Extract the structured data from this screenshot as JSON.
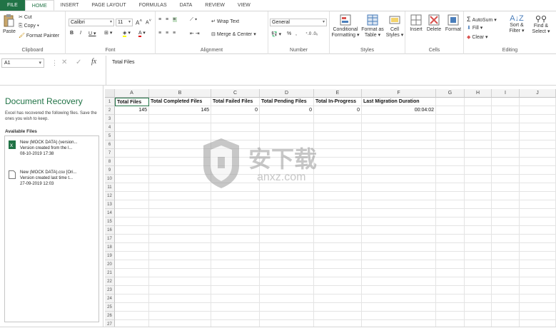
{
  "menu": {
    "tabs": [
      "FILE",
      "HOME",
      "INSERT",
      "PAGE LAYOUT",
      "FORMULAS",
      "DATA",
      "REVIEW",
      "VIEW"
    ],
    "active_tab": "HOME"
  },
  "ribbon": {
    "clipboard": {
      "paste": "Paste",
      "cut": "Cut",
      "copy": "Copy",
      "format_painter": "Format Painter",
      "label": "Clipboard"
    },
    "font": {
      "name": "Calibri",
      "size": "11",
      "label": "Font"
    },
    "alignment": {
      "wrap_text": "Wrap Text",
      "merge_center": "Merge & Center",
      "label": "Alignment"
    },
    "number": {
      "format": "General",
      "label": "Number"
    },
    "styles": {
      "conditional": "Conditional",
      "conditional2": "Formatting",
      "format_as": "Format as",
      "format_as2": "Table",
      "cell": "Cell",
      "cell2": "Styles",
      "label": "Styles"
    },
    "cells": {
      "insert": "Insert",
      "delete": "Delete",
      "format": "Format",
      "label": "Cells"
    },
    "editing": {
      "autosum": "AutoSum",
      "fill": "Fill",
      "clear": "Clear",
      "sort": "Sort &",
      "sort2": "Filter",
      "find": "Find &",
      "find2": "Select",
      "label": "Editing"
    }
  },
  "formula_bar": {
    "name_box": "A1",
    "fx": "fx",
    "content": "Total Files"
  },
  "recovery": {
    "title": "Document Recovery",
    "description": "Excel has recovered the following files. Save the ones you wish to keep.",
    "available": "Available Files",
    "files": [
      {
        "name": "New (MOCK DATA) (version...",
        "detail": "Version created from the l...",
        "date": "08-10-2019 17:38"
      },
      {
        "name": "New (MOCK DATA).csv  [Ori...",
        "detail": "Version created last time t...",
        "date": "27-09-2019 12:03"
      }
    ]
  },
  "sheet": {
    "columns": [
      "A",
      "B",
      "C",
      "D",
      "E",
      "F",
      "G",
      "H",
      "I",
      "J"
    ],
    "headers": [
      "Total Files",
      "Total Completed Files",
      "Total Failed Files",
      "Total Pending Files",
      "Total In-Progress",
      "Last Migration Duration"
    ],
    "values": [
      "145",
      "145",
      "0",
      "0",
      "0",
      "00:04:02"
    ],
    "row_numbers": [
      "1",
      "2",
      "3",
      "4",
      "5",
      "6",
      "7",
      "8",
      "9",
      "10",
      "11",
      "12",
      "13",
      "14",
      "15",
      "16",
      "17",
      "18",
      "19",
      "20",
      "21",
      "22",
      "23",
      "24",
      "25",
      "26",
      "27"
    ]
  },
  "watermark": {
    "text": "安下载",
    "sub": "anxz.com"
  },
  "colors": {
    "excel_green": "#217346",
    "ribbon_border": "#d6d6d6"
  }
}
